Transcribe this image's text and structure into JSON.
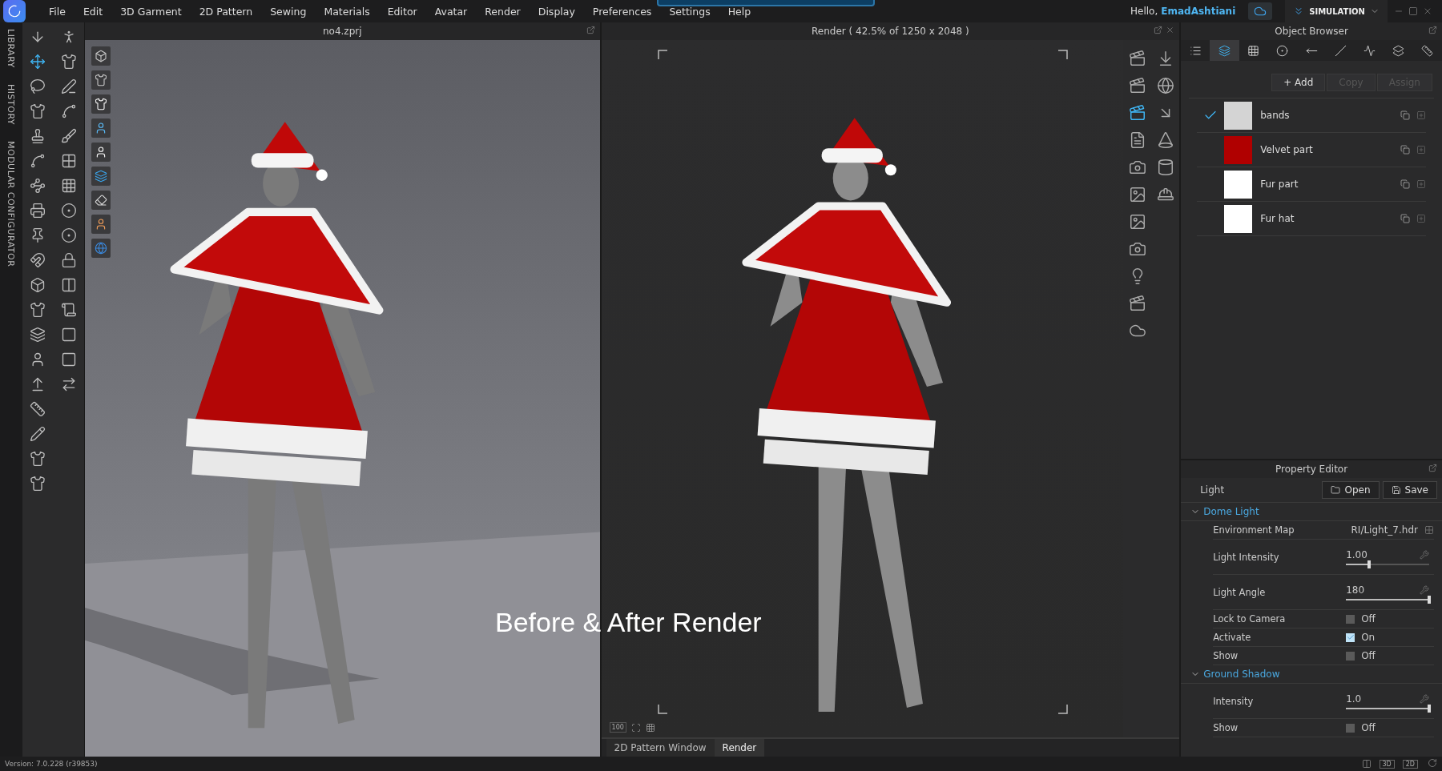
{
  "menu_bar": {
    "items": [
      "File",
      "Edit",
      "3D Garment",
      "2D Pattern",
      "Sewing",
      "Materials",
      "Editor",
      "Avatar",
      "Render",
      "Display",
      "Preferences",
      "Settings",
      "Help"
    ],
    "greeting": "Hello,",
    "user": "EmadAshtiani",
    "mode": "SIMULATION"
  },
  "side_tabs": [
    "LIBRARY",
    "HISTORY",
    "MODULAR CONFIGURATOR"
  ],
  "viewport_3d": {
    "title": "no4.zprj"
  },
  "render_view": {
    "title": "Render ( 42.5% of 1250 x 2048 )",
    "zoom_label": "100"
  },
  "caption": "Before & After Render",
  "bottom_tabs": [
    {
      "label": "2D Pattern Window",
      "selected": false
    },
    {
      "label": "Render",
      "selected": true
    }
  ],
  "object_browser": {
    "title": "Object Browser",
    "tabs": [
      {
        "selected": false
      },
      {
        "selected": true
      },
      {
        "selected": false
      },
      {
        "selected": false
      },
      {
        "selected": false
      },
      {
        "selected": false
      },
      {
        "selected": false
      },
      {
        "selected": false
      },
      {
        "selected": false
      }
    ],
    "actions": [
      {
        "label": "+ Add",
        "disabled": false
      },
      {
        "label": "Copy",
        "disabled": true
      },
      {
        "label": "Assign",
        "disabled": true
      }
    ],
    "materials": [
      {
        "name": "bands",
        "color": "#d4d4d4",
        "selected": true
      },
      {
        "name": "Velvet part",
        "color": "#b00000",
        "selected": false
      },
      {
        "name": "Fur part",
        "color": "#ffffff",
        "selected": false
      },
      {
        "name": "Fur hat",
        "color": "#ffffff",
        "selected": false
      }
    ]
  },
  "property_editor": {
    "title": "Property Editor",
    "object": "Light",
    "buttons": [
      "Open",
      "Save"
    ],
    "sections": [
      {
        "title": "Dome Light",
        "expanded": true,
        "properties": [
          {
            "kind": "file",
            "label": "Environment Map",
            "value": "RI/Light_7.hdr"
          },
          {
            "kind": "slider",
            "label": "Light Intensity",
            "value": "1.00",
            "level": 0.28
          },
          {
            "kind": "slider",
            "label": "Light Angle",
            "value": "180",
            "level": 1
          },
          {
            "kind": "toggle",
            "label": "Lock to Camera",
            "checked": false,
            "state": "Off"
          },
          {
            "kind": "toggle",
            "label": "Activate",
            "checked": true,
            "state": "On"
          },
          {
            "kind": "toggle",
            "label": "Show",
            "checked": false,
            "state": "Off"
          }
        ]
      },
      {
        "title": "Ground Shadow",
        "expanded": true,
        "properties": [
          {
            "kind": "slider",
            "label": "Intensity",
            "value": "1.0",
            "level": 1
          },
          {
            "kind": "toggle",
            "label": "Show",
            "checked": false,
            "state": "Off"
          }
        ]
      }
    ]
  },
  "status_bar": {
    "version": "Version: 7.0.228 (r39853)",
    "views": [
      "3D",
      "2D"
    ]
  }
}
